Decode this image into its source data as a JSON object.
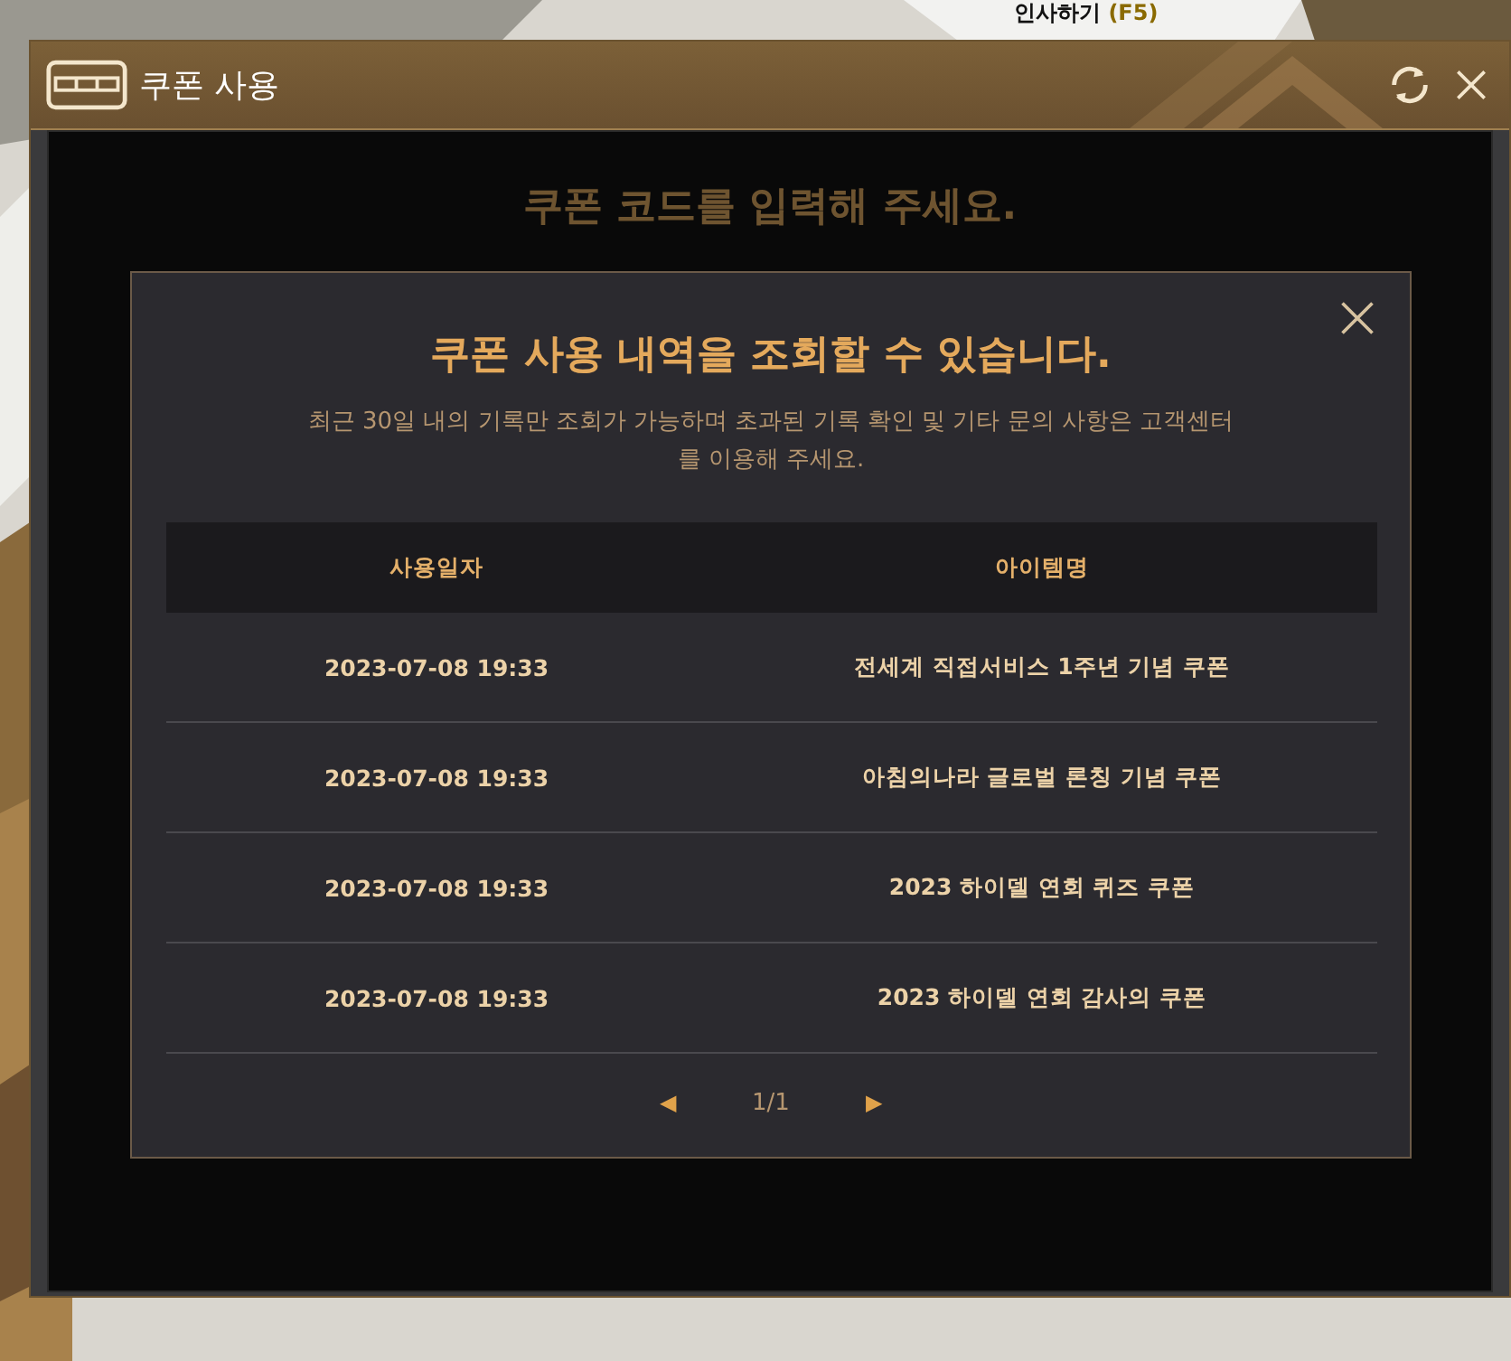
{
  "hud_label": {
    "text": "인사하기",
    "key": "(F5)"
  },
  "window": {
    "title": "쿠폰 사용"
  },
  "background_panel": {
    "heading": "쿠폰 코드를 입력해 주세요."
  },
  "history_dialog": {
    "title": "쿠폰 사용 내역을 조회할 수 있습니다.",
    "description": "최근 30일 내의 기록만 조회가 가능하며 초과된 기록 확인 및 기타 문의 사항은 고객센터를 이용해 주세요.",
    "table": {
      "columns": [
        "사용일자",
        "아이템명"
      ],
      "rows": [
        {
          "date": "2023-07-08 19:33",
          "item": "전세계 직접서비스 1주년 기념 쿠폰"
        },
        {
          "date": "2023-07-08 19:33",
          "item": "아침의나라 글로벌 론칭 기념 쿠폰"
        },
        {
          "date": "2023-07-08 19:33",
          "item": "2023 하이델 연회 퀴즈 쿠폰"
        },
        {
          "date": "2023-07-08 19:33",
          "item": "2023 하이델 연회 감사의 쿠폰"
        }
      ]
    },
    "pagination": {
      "prev": "◀",
      "page": "1/1",
      "next": "▶"
    }
  }
}
